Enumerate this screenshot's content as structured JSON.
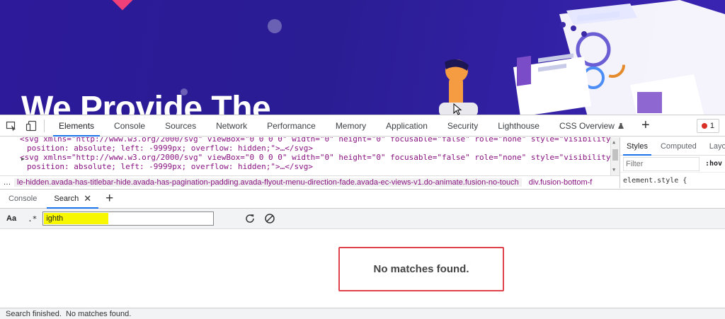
{
  "page": {
    "hero_title": "We Provide The"
  },
  "devtools": {
    "main_tabs": [
      {
        "label": "Elements"
      },
      {
        "label": "Console"
      },
      {
        "label": "Sources"
      },
      {
        "label": "Network"
      },
      {
        "label": "Performance"
      },
      {
        "label": "Memory"
      },
      {
        "label": "Application"
      },
      {
        "label": "Security"
      },
      {
        "label": "Lighthouse"
      },
      {
        "label": "CSS Overview"
      }
    ],
    "active_main_tab": "Elements",
    "error_count": "1",
    "elements": {
      "line1": "<svg xmlns=\"http://www.w3.org/2000/svg\" viewBox=\"0 0 0 0\" width=\"0\" height=\"0\" focusable=\"false\" role=\"none\" style=\"visibility: hidden;",
      "line2": "position: absolute; left: -9999px; overflow: hidden;\">…</svg>",
      "line3": "<svg xmlns=\"http://www.w3.org/2000/svg\" viewBox=\"0 0 0 0\" width=\"0\" height=\"0\" focusable=\"false\" role=\"none\" style=\"visibility: hidden;",
      "line4": "position: absolute; left: -9999px; overflow: hidden;\">…</svg>"
    },
    "breadcrumb": {
      "more": "…",
      "selected": "le-hidden.avada-has-titlebar-hide.avada-has-pagination-padding.avada-flyout-menu-direction-fade.avada-ec-views-v1.do-animate.fusion-no-touch",
      "next": "div.fusion-bottom-f"
    },
    "styles_pane": {
      "tabs": [
        "Styles",
        "Computed",
        "Layo"
      ],
      "filter_placeholder": "Filter",
      "hov": ":hov",
      "element_style": "element.style {"
    },
    "drawer": {
      "tabs": [
        {
          "label": "Console"
        },
        {
          "label": "Search"
        }
      ],
      "active_tab": "Search",
      "match_case_label": "Aa",
      "regex_label": ".*",
      "search_value": "ighth",
      "no_matches": "No matches found.",
      "status": "Search finished.  No matches found."
    }
  }
}
